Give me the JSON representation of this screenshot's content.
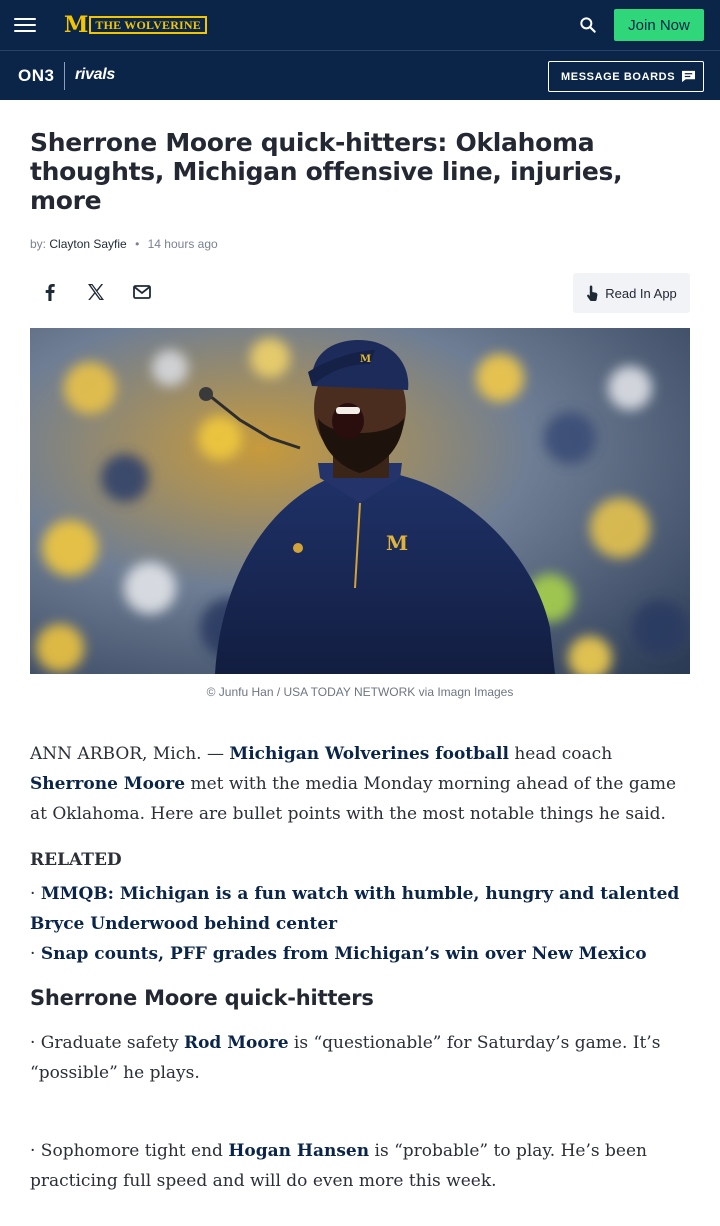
{
  "header": {
    "menu_icon": "hamburger-menu-icon",
    "logo_letter": "M",
    "logo_text": "THE WOLVERINE",
    "search_icon": "search-icon",
    "join_label": "Join Now",
    "join_color": "#2fd67a",
    "bar_color": "#0b2549"
  },
  "subnav": {
    "on3_label": "ON3",
    "rivals_label": "rivals",
    "message_boards_label": "MESSAGE BOARDS",
    "message_icon": "message-icon"
  },
  "article": {
    "headline": "Sherrone Moore quick-hitters: Oklahoma thoughts, Michigan offensive line, injuries, more",
    "by_prefix": "by:",
    "author": "Clayton Sayfie",
    "dot": "•",
    "time_ago": "14 hours ago",
    "share_icons": [
      "facebook-icon",
      "x-icon",
      "email-icon"
    ],
    "read_in_app_label": "Read In App",
    "photo_caption": "© Junfu Han / USA TODAY NETWORK via Imagn Images",
    "intro": {
      "prefix": "ANN ARBOR, Mich. — ",
      "link1": "Michigan Wolverines football",
      "mid": " head coach ",
      "link2": "Sherrone Moore",
      "suffix": " met with the media Monday morning ahead of the game at Oklahoma. Here are bullet points with the most notable things he said."
    },
    "related_heading": "RELATED",
    "related": [
      {
        "bullet": "· ",
        "label": "MMQB: Michigan is a fun watch with humble, hungry and talented Bryce Underwood behind center"
      },
      {
        "bullet": "· ",
        "label": "Snap counts, PFF grades from Michigan’s win over New Mexico"
      }
    ],
    "subhead": "Sherrone Moore quick-hitters",
    "bullets": [
      {
        "prefix": "· Graduate safety ",
        "link": "Rod Moore",
        "suffix": " is “questionable” for Saturday’s game. It’s “possible” he plays."
      },
      {
        "prefix": "· Sophomore tight end ",
        "link": "Hogan Hansen",
        "suffix": " is “probable” to play. He’s been practicing full speed and will do even more this week."
      }
    ]
  }
}
